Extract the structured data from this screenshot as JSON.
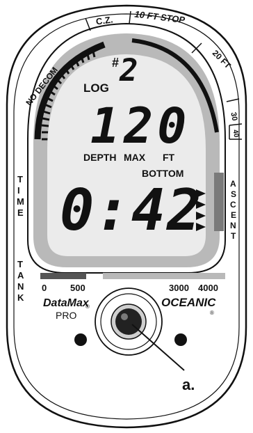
{
  "device": {
    "brand": "OCEANIC",
    "model": "DataMax",
    "model_sub": "PRO",
    "registered": "®"
  },
  "bezel": {
    "zone_cz": "C.Z.",
    "zone_stop": "10 FT  STOP",
    "zone_20ft": "20 FT",
    "depth_30": "30",
    "depth_40": "40",
    "no_decom": "NO DECOM",
    "time_letters": [
      "T",
      "I",
      "M",
      "E"
    ],
    "tank_letters": [
      "T",
      "A",
      "N",
      "K"
    ],
    "ascent_letters": [
      "A",
      "S",
      "C",
      "E",
      "N",
      "T"
    ]
  },
  "display": {
    "log_hash": "#",
    "log_label": "LOG",
    "log_number": "2",
    "max_depth_value": "120",
    "depth_label": "DEPTH",
    "max_label": "MAX",
    "ft_label": "FT",
    "bottom_label": "BOTTOM",
    "bottom_time": "0:42"
  },
  "pressure_scale": {
    "ticks": [
      "0",
      "500",
      "3000",
      "4000"
    ]
  },
  "callout": {
    "label": "a."
  },
  "colors": {
    "bezel_gray": "#b9b9b9",
    "lcd_gray": "#ebebeb",
    "ink": "#111111"
  }
}
